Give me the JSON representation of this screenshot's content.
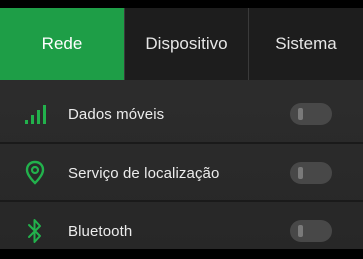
{
  "tabs": [
    {
      "label": "Rede",
      "active": true
    },
    {
      "label": "Dispositivo",
      "active": false
    },
    {
      "label": "Sistema",
      "active": false
    }
  ],
  "settings": [
    {
      "label": "Dados móveis",
      "icon": "signal-bars-icon",
      "enabled": false
    },
    {
      "label": "Serviço de localização",
      "icon": "location-pin-icon",
      "enabled": false
    },
    {
      "label": "Bluetooth",
      "icon": "bluetooth-icon",
      "enabled": false
    }
  ],
  "colors": {
    "accent": "#1e9e47",
    "icon_green": "#22b14c",
    "background": "#2c2c2c",
    "toggle_off": "#484848"
  }
}
